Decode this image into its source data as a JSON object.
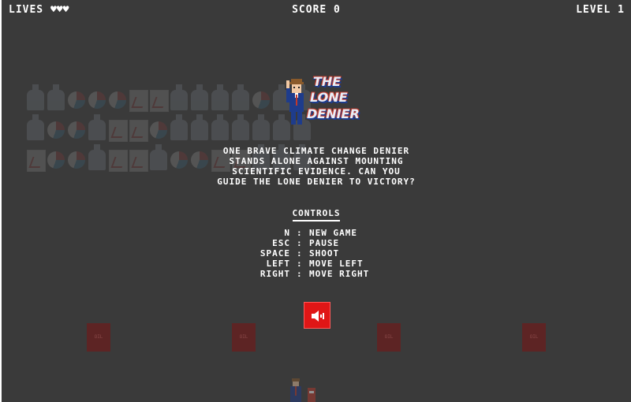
{
  "hud": {
    "lives_label": "LIVES",
    "hearts": "♥♥♥",
    "score_label": "SCORE 0",
    "level_label": "LEVEL 1"
  },
  "logo": {
    "line1": "THE",
    "line2": "LONE",
    "line3": "DENIER"
  },
  "intro": {
    "lines": [
      "ONE BRAVE CLIMATE CHANGE DENIER",
      "STANDS ALONE AGAINST MOUNTING",
      "SCIENTIFIC EVIDENCE. CAN YOU",
      "GUIDE THE LONE DENIER TO VICTORY?"
    ]
  },
  "controls": {
    "title": "CONTROLS",
    "items": [
      {
        "key": "N",
        "action": "NEW GAME"
      },
      {
        "key": "ESC",
        "action": "PAUSE"
      },
      {
        "key": "SPACE",
        "action": "SHOOT"
      },
      {
        "key": "LEFT",
        "action": "MOVE LEFT"
      },
      {
        "key": "RIGHT",
        "action": "MOVE RIGHT"
      }
    ]
  },
  "barrels": {
    "label": "OIL"
  },
  "sound_button": {
    "icon": "speaker-icon",
    "color": "#e01616"
  },
  "invaders": {
    "rows": [
      [
        "bottle",
        "bottle",
        "gauge",
        "gauge",
        "gauge",
        "chart",
        "chart",
        "bottle",
        "bottle",
        "bottle",
        "bottle",
        "gauge",
        "bottle",
        "bottle"
      ],
      [
        "bottle",
        "gauge",
        "gauge",
        "bottle",
        "chart",
        "chart",
        "gauge",
        "bottle",
        "bottle",
        "bottle",
        "bottle",
        "bottle",
        "bottle",
        "bottle"
      ],
      [
        "chart",
        "gauge",
        "gauge",
        "bottle",
        "chart",
        "chart",
        "bottle",
        "gauge",
        "gauge",
        "chart",
        "chart",
        "bottle",
        "bottle",
        "bottle"
      ]
    ]
  }
}
